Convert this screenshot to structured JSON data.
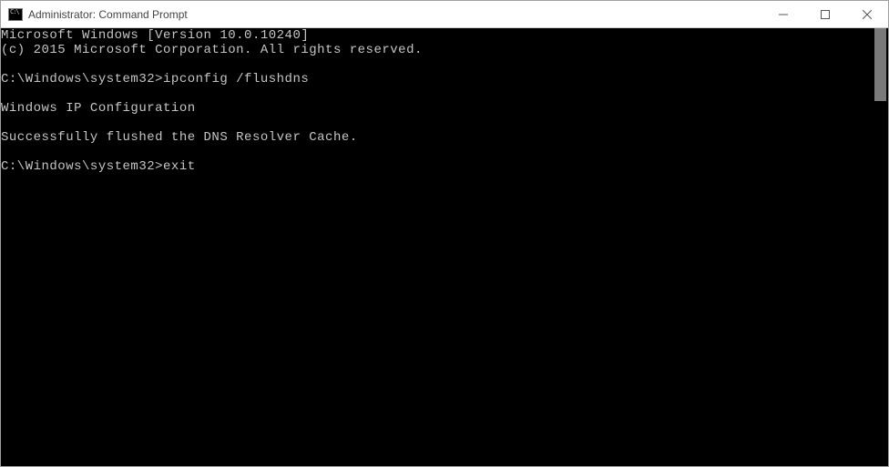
{
  "window": {
    "title": "Administrator: Command Prompt"
  },
  "terminal": {
    "lines": [
      "Microsoft Windows [Version 10.0.10240]",
      "(c) 2015 Microsoft Corporation. All rights reserved.",
      "",
      "C:\\Windows\\system32>ipconfig /flushdns",
      "",
      "Windows IP Configuration",
      "",
      "Successfully flushed the DNS Resolver Cache.",
      "",
      "C:\\Windows\\system32>exit"
    ],
    "prompt": "C:\\Windows\\system32>",
    "command1": "ipconfig /flushdns",
    "command2": "exit",
    "banner_line1": "Microsoft Windows [Version 10.0.10240]",
    "banner_line2": "(c) 2015 Microsoft Corporation. All rights reserved.",
    "output_header": "Windows IP Configuration",
    "output_result": "Successfully flushed the DNS Resolver Cache."
  }
}
